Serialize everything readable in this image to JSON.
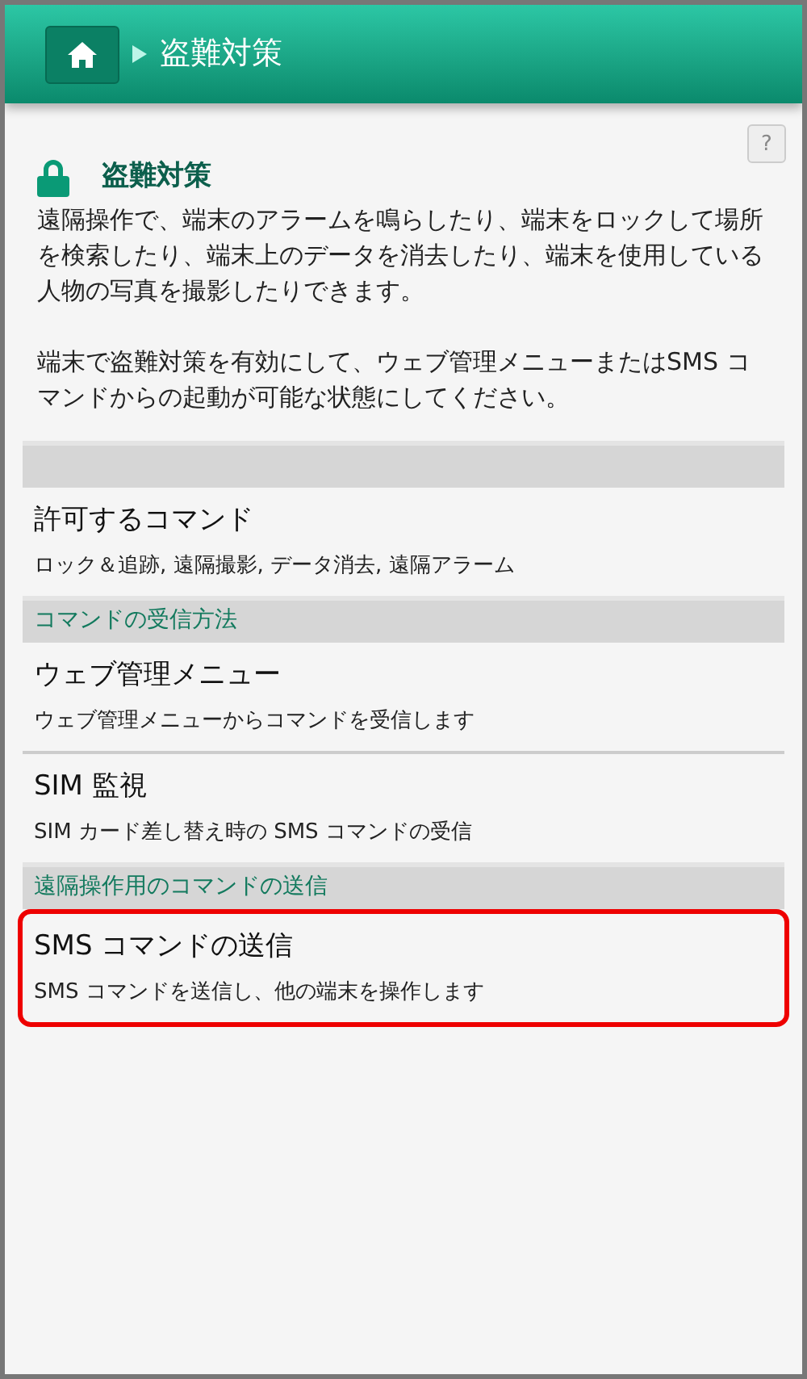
{
  "header": {
    "title": "盗難対策"
  },
  "help": {
    "label": "?"
  },
  "intro": {
    "title": "盗難対策",
    "paragraphs": [
      "遠隔操作で、端末のアラームを鳴らしたり、端末をロックして場所を検索したり、端末上のデータを消去したり、端末を使用している人物の写真を撮影したりできます。",
      "端末で盗難対策を有効にして、ウェブ管理メニューまたはSMS コマンドからの起動が可能な状態にしてください。"
    ]
  },
  "list": [
    {
      "kind": "section"
    },
    {
      "kind": "item",
      "title": "許可するコマンド",
      "subtitle": "ロック＆追跡, 遠隔撮影, データ消去, 遠隔アラーム",
      "highlighted": false
    },
    {
      "kind": "section",
      "label": "コマンドの受信方法"
    },
    {
      "kind": "item",
      "title": "ウェブ管理メニュー",
      "subtitle": "ウェブ管理メニューからコマンドを受信します",
      "highlighted": false
    },
    {
      "kind": "item",
      "title": "SIM 監視",
      "subtitle": "SIM カード差し替え時の SMS コマンドの受信",
      "highlighted": false
    },
    {
      "kind": "section",
      "label": "遠隔操作用のコマンドの送信"
    },
    {
      "kind": "item",
      "title": "SMS コマンドの送信",
      "subtitle": "SMS コマンドを送信し、他の端末を操作します",
      "highlighted": true
    }
  ]
}
